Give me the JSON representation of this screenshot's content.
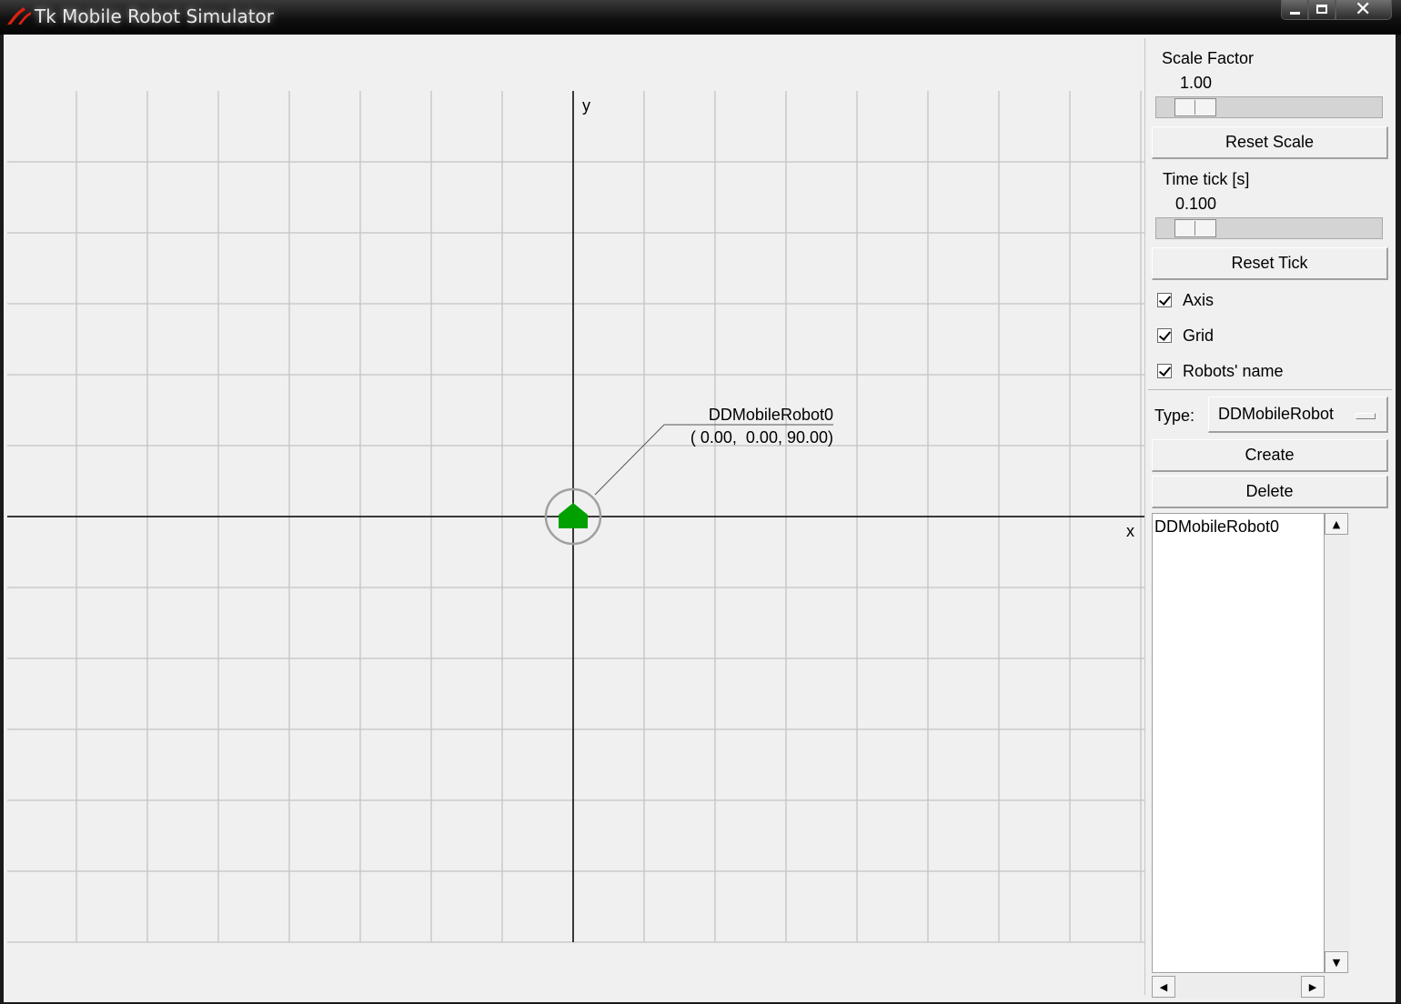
{
  "window": {
    "title": "Tk Mobile Robot Simulator",
    "icon": "tk-feather-icon",
    "controls": [
      "minimize-icon",
      "maximize-icon",
      "close-icon"
    ]
  },
  "canvas": {
    "x_axis_label": "x",
    "y_axis_label": "y",
    "show_axis": true,
    "show_grid": true,
    "robot": {
      "name": "DDMobileRobot0",
      "pose_text": "( 0.00,  0.00, 90.00)",
      "x": 0.0,
      "y": 0.0,
      "theta_deg": 90.0,
      "color": "#00a000"
    }
  },
  "panel": {
    "scale": {
      "label": "Scale Factor",
      "value": "1.00",
      "reset_label": "Reset Scale"
    },
    "tick": {
      "label": "Time tick [s]",
      "value": "0.100",
      "reset_label": "Reset Tick"
    },
    "checks": [
      {
        "label": "Axis",
        "checked": true
      },
      {
        "label": "Grid",
        "checked": true
      },
      {
        "label": "Robots' name",
        "checked": true
      }
    ],
    "type": {
      "label": "Type:",
      "value": "DDMobileRobot"
    },
    "create_label": "Create",
    "delete_label": "Delete",
    "robots": [
      "DDMobileRobot0"
    ]
  }
}
